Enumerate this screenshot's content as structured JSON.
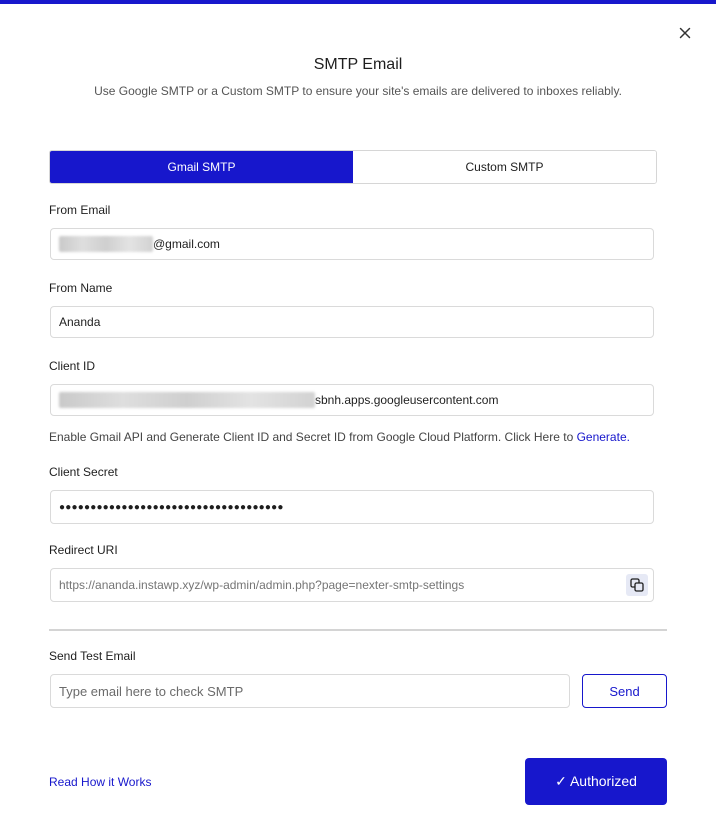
{
  "dialog": {
    "title": "SMTP Email",
    "subtitle": "Use Google SMTP or a Custom SMTP to ensure your site's emails are delivered to inboxes reliably.",
    "close_icon": "close-icon"
  },
  "tabs": [
    {
      "label": "Gmail SMTP",
      "active": true
    },
    {
      "label": "Custom SMTP",
      "active": false
    }
  ],
  "from_email": {
    "label": "From Email",
    "value_suffix": "@gmail.com"
  },
  "from_name": {
    "label": "From Name",
    "value": "Ananda"
  },
  "client_id": {
    "label": "Client ID",
    "value_suffix": "sbnh.apps.googleusercontent.com",
    "help_text": "Enable Gmail API and Generate Client ID and Secret ID from Google Cloud Platform. Click Here to ",
    "help_link": "Generate.",
    "link_color": "#1717cc"
  },
  "client_secret": {
    "label": "Client Secret",
    "value": "●●●●●●●●●●●●●●●●●●●●●●●●●●●●●●●●●●●●"
  },
  "redirect_uri": {
    "label": "Redirect URI",
    "value": "https://ananda.instawp.xyz/wp-admin/admin.php?page=nexter-smtp-settings",
    "copy_icon": "copy-icon"
  },
  "test_email": {
    "label": "Send Test Email",
    "placeholder": "Type email here to check SMTP",
    "send_label": "Send"
  },
  "footer": {
    "read_link": "Read How it Works",
    "authorized_label": "✓ Authorized"
  },
  "colors": {
    "accent": "#1717cc"
  }
}
